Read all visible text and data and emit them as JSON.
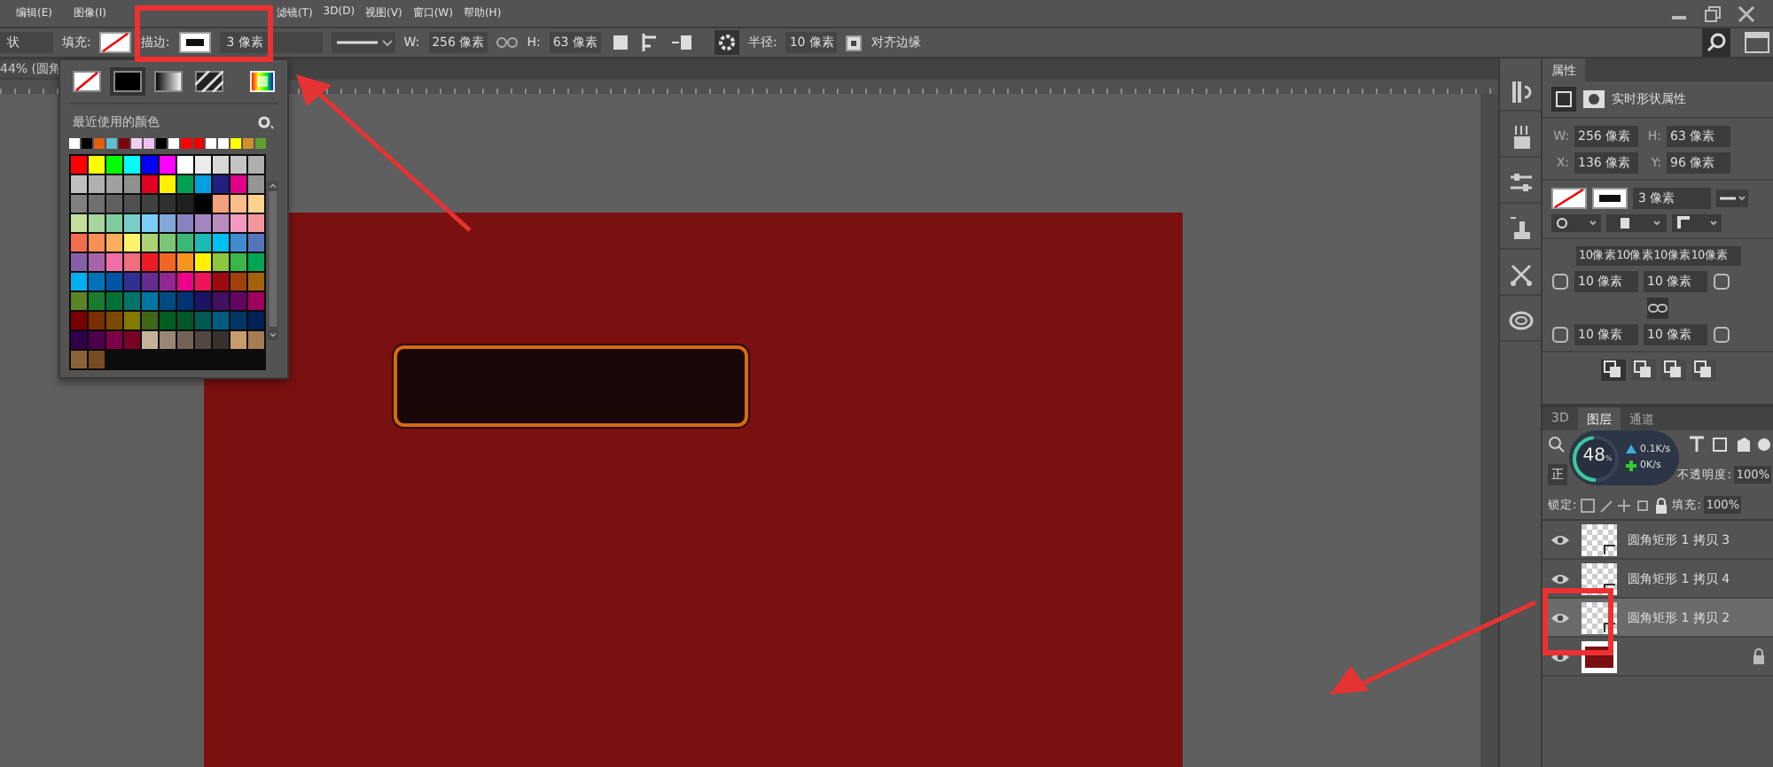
{
  "menu": [
    "编辑(E)",
    "图像(I)",
    "滤镜(T)",
    "3D(D)",
    "视图(V)",
    "窗口(W)",
    "帮助(H)"
  ],
  "options_bar": {
    "tool": "状",
    "fill_label": "填充:",
    "stroke_label": "描边:",
    "stroke_width": "3 像素",
    "w_label": "W:",
    "w": "256 像素",
    "h_label": "H:",
    "h": "63 像素",
    "radius_label": "半径:",
    "radius": "10 像素",
    "align_edges": {
      "label": "对齐边缘",
      "checked": true
    }
  },
  "document_tab": "44% (圆角",
  "swatch_popup": {
    "title": "最近使用的颜色",
    "fill_types": [
      {
        "kind": "none",
        "selected": false
      },
      {
        "kind": "solid",
        "selected": true
      },
      {
        "kind": "gradient",
        "selected": false
      },
      {
        "kind": "pattern",
        "selected": false
      },
      {
        "kind": "picker",
        "selected": false
      }
    ],
    "recent": [
      {
        "color": "#ffffff"
      },
      {
        "color": "#000000"
      },
      {
        "color": "#e06010"
      },
      {
        "color": "#60c0d0"
      },
      {
        "color": "#800010"
      },
      {
        "color": "#f0d0f0"
      },
      {
        "color": "#f0c0f0"
      },
      {
        "color": "#000000"
      },
      {
        "color": "#ffffff"
      },
      {
        "color": "#ff0000"
      },
      {
        "color": "#ee0000"
      },
      {
        "color": "#ffffff"
      },
      {
        "color": "#fefefe"
      },
      {
        "color": "#ffff00"
      },
      {
        "color": "#d09030"
      },
      {
        "color": "#60a030"
      }
    ],
    "swatches": [
      {
        "color": "#ff0000"
      },
      {
        "color": "#ffff00"
      },
      {
        "color": "#00ff00"
      },
      {
        "color": "#00ffff"
      },
      {
        "color": "#0000ff"
      },
      {
        "color": "#ff00ff"
      },
      {
        "color": "#ffffff"
      },
      {
        "color": "#ebebeb"
      },
      {
        "color": "#d7d7d7"
      },
      {
        "color": "#c3c3c3"
      },
      {
        "color": "#afafaf"
      },
      {
        "color": "#c0c0c0"
      },
      {
        "color": "#b0b0b0"
      },
      {
        "color": "#a0a0a0"
      },
      {
        "color": "#909090"
      },
      {
        "color": "#e00020"
      },
      {
        "color": "#fff000"
      },
      {
        "color": "#00a050"
      },
      {
        "color": "#00a0e0"
      },
      {
        "color": "#202080"
      },
      {
        "color": "#e0008a"
      },
      {
        "color": "#959595"
      },
      {
        "color": "#808080"
      },
      {
        "color": "#707070"
      },
      {
        "color": "#606060"
      },
      {
        "color": "#505050"
      },
      {
        "color": "#404040"
      },
      {
        "color": "#303030"
      },
      {
        "color": "#202020"
      },
      {
        "color": "#010101"
      },
      {
        "color": "#f4a07a"
      },
      {
        "color": "#f9bd8a"
      },
      {
        "color": "#fdd38d"
      },
      {
        "color": "#c5df9a"
      },
      {
        "color": "#a5d59a"
      },
      {
        "color": "#7fcba0"
      },
      {
        "color": "#7accc8"
      },
      {
        "color": "#7acdf4"
      },
      {
        "color": "#83a8d7"
      },
      {
        "color": "#8882c1"
      },
      {
        "color": "#a286bd"
      },
      {
        "color": "#bd8cbf"
      },
      {
        "color": "#f49ac1"
      },
      {
        "color": "#f5989d"
      },
      {
        "color": "#f26c4f"
      },
      {
        "color": "#f68e55"
      },
      {
        "color": "#fbaf5c"
      },
      {
        "color": "#fff467"
      },
      {
        "color": "#acd372"
      },
      {
        "color": "#7cc576"
      },
      {
        "color": "#3bb878"
      },
      {
        "color": "#1abbb4"
      },
      {
        "color": "#00bff3"
      },
      {
        "color": "#438ccb"
      },
      {
        "color": "#5674b9"
      },
      {
        "color": "#8560a8"
      },
      {
        "color": "#a864a8"
      },
      {
        "color": "#f06eaa"
      },
      {
        "color": "#f26d7d"
      },
      {
        "color": "#ed1c24"
      },
      {
        "color": "#f26522"
      },
      {
        "color": "#f7941d"
      },
      {
        "color": "#fff200"
      },
      {
        "color": "#8dc63f"
      },
      {
        "color": "#39b54a"
      },
      {
        "color": "#00a651"
      },
      {
        "color": "#00aeef"
      },
      {
        "color": "#0072bc"
      },
      {
        "color": "#0054a6"
      },
      {
        "color": "#2e3192"
      },
      {
        "color": "#662d91"
      },
      {
        "color": "#92278f"
      },
      {
        "color": "#ec008c"
      },
      {
        "color": "#ed145b"
      },
      {
        "color": "#9e0b0f"
      },
      {
        "color": "#a0410d"
      },
      {
        "color": "#a3620a"
      },
      {
        "color": "#598527"
      },
      {
        "color": "#1a7b30"
      },
      {
        "color": "#007236"
      },
      {
        "color": "#00746b"
      },
      {
        "color": "#0076a3"
      },
      {
        "color": "#004b80"
      },
      {
        "color": "#003471"
      },
      {
        "color": "#1b1464"
      },
      {
        "color": "#440e62"
      },
      {
        "color": "#630460"
      },
      {
        "color": "#9e005d"
      },
      {
        "color": "#790000"
      },
      {
        "color": "#7b2e00"
      },
      {
        "color": "#7d4900"
      },
      {
        "color": "#827b00"
      },
      {
        "color": "#406618"
      },
      {
        "color": "#005e20"
      },
      {
        "color": "#005826"
      },
      {
        "color": "#005952"
      },
      {
        "color": "#005b7f"
      },
      {
        "color": "#003663"
      },
      {
        "color": "#002157"
      },
      {
        "color": "#32004b"
      },
      {
        "color": "#4b0049"
      },
      {
        "color": "#7b0046"
      },
      {
        "color": "#7a0026"
      },
      {
        "color": "#c7b299"
      },
      {
        "color": "#998675"
      },
      {
        "color": "#736357"
      },
      {
        "color": "#534741"
      },
      {
        "color": "#37302d"
      },
      {
        "color": "#c69c6d"
      },
      {
        "color": "#a67c52"
      },
      {
        "color": "#8c6239"
      },
      {
        "color": "#754c24"
      }
    ]
  },
  "properties": {
    "title": "属性",
    "subtitle": "实时形状属性",
    "w_label": "W:",
    "w": "256 像素",
    "h_label": "H:",
    "h": "63 像素",
    "x_label": "X:",
    "x": "136 像素",
    "y_label": "Y:",
    "y": "96 像素",
    "stroke_width": "3 像素",
    "corner_radii": "10像素10像素10像素10像素",
    "corners": [
      "10 像素",
      "10 像素",
      "10 像素",
      "10 像素"
    ]
  },
  "layers_panel": {
    "tabs": [
      {
        "label": "3D",
        "selected": false
      },
      {
        "label": "图层",
        "selected": true
      },
      {
        "label": "通道",
        "selected": false
      }
    ],
    "blend_mode": "正",
    "opacity_label": "不透明度:",
    "opacity": "100%",
    "lock_label": "锁定:",
    "fill_label": "填充:",
    "fill": "100%",
    "layers": [
      {
        "kind": "shape",
        "name": "圆角矩形 1 拷贝 3",
        "visible": true,
        "selected": false
      },
      {
        "kind": "shape",
        "name": "圆角矩形 1 拷贝 4",
        "visible": true,
        "selected": false
      },
      {
        "kind": "shape",
        "name": "圆角矩形 1 拷贝 2",
        "visible": true,
        "selected": true
      },
      {
        "kind": "background",
        "visible": true,
        "selected": false,
        "locked": true
      }
    ]
  },
  "speed_widget": {
    "percent": "48",
    "unit": "%",
    "up": "0.1K/s",
    "down": "0K/s"
  }
}
